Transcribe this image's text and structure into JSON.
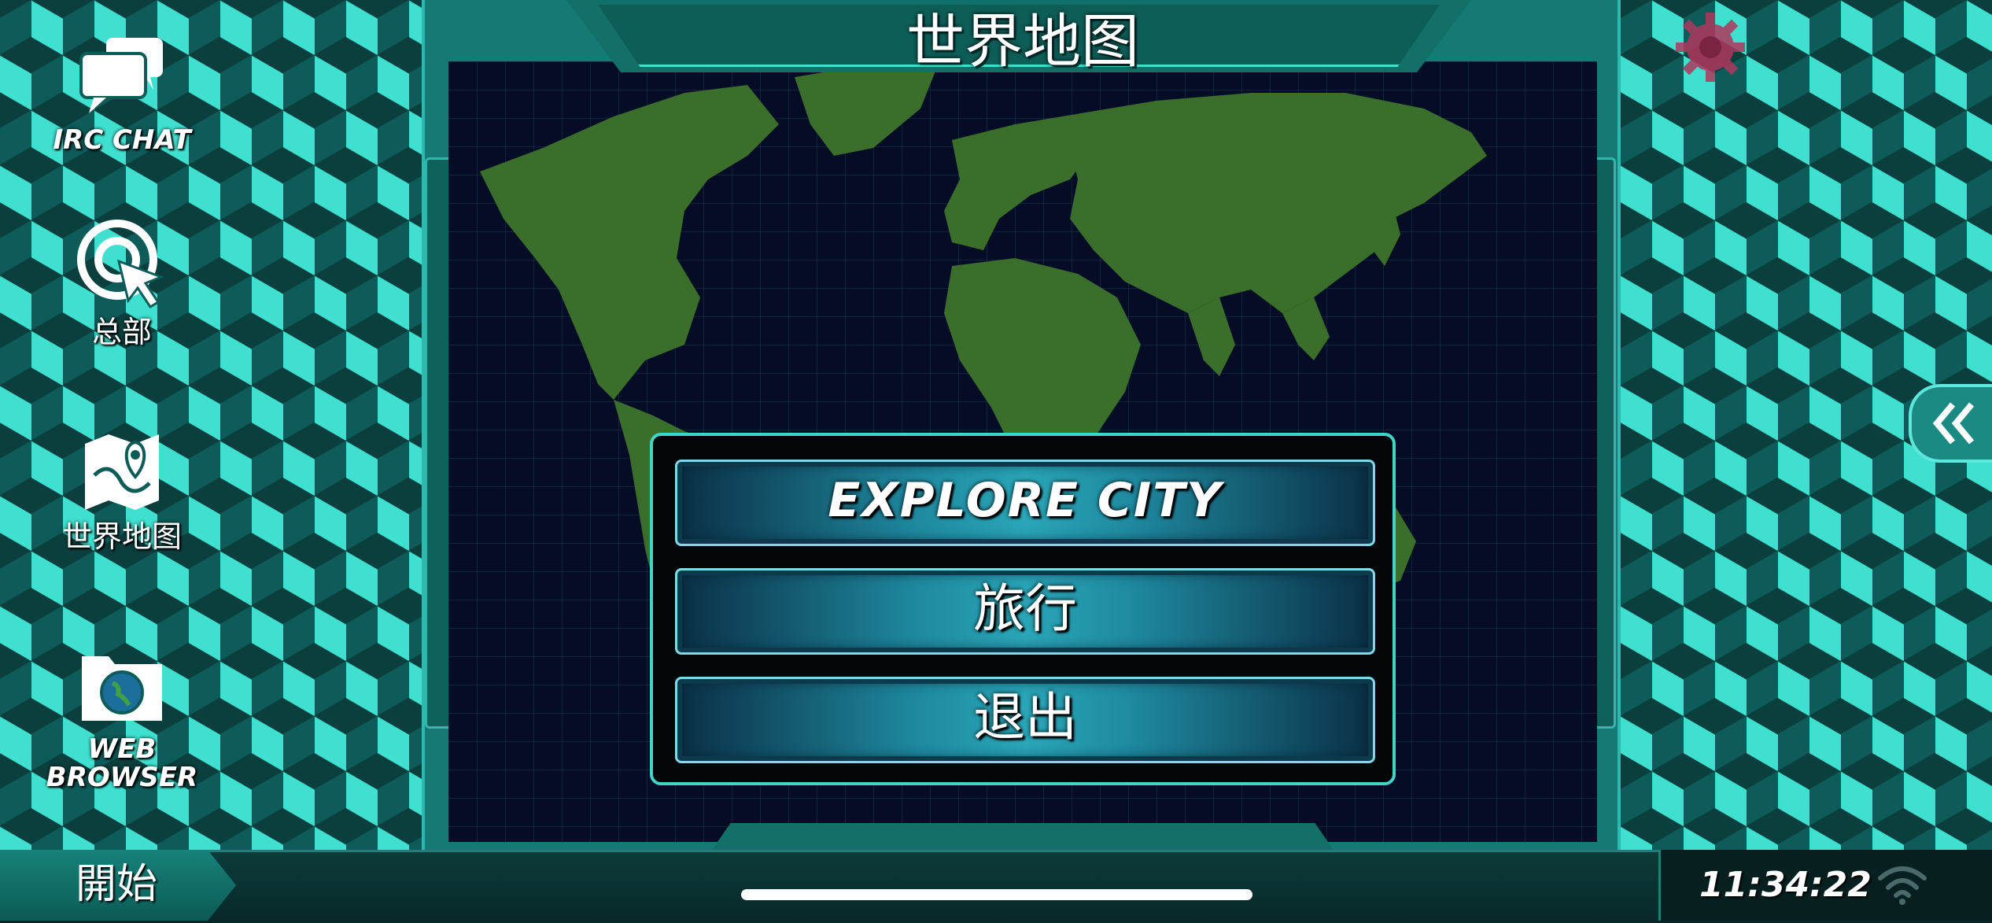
{
  "window": {
    "title": "世界地图"
  },
  "desktop_icons": [
    {
      "name": "irc-chat",
      "label": "IRC CHAT"
    },
    {
      "name": "headquarters",
      "label": "总部"
    },
    {
      "name": "world-map",
      "label": "世界地图"
    },
    {
      "name": "web-browser",
      "label": "WEB BROWSER"
    }
  ],
  "menu": {
    "buttons": [
      {
        "label": "EXPLORE CITY"
      },
      {
        "label": "旅行"
      },
      {
        "label": "退出"
      }
    ]
  },
  "taskbar": {
    "start_label": "開始",
    "clock": "11:34:22"
  },
  "colors": {
    "accent": "#3fe0d0",
    "map_land": "#3a6e2a",
    "map_ocean": "#050d26",
    "gear": "#b0375e"
  },
  "icons": {
    "settings": "gear-icon",
    "collapse": "double-chevron-left-icon",
    "network": "wifi-icon"
  }
}
